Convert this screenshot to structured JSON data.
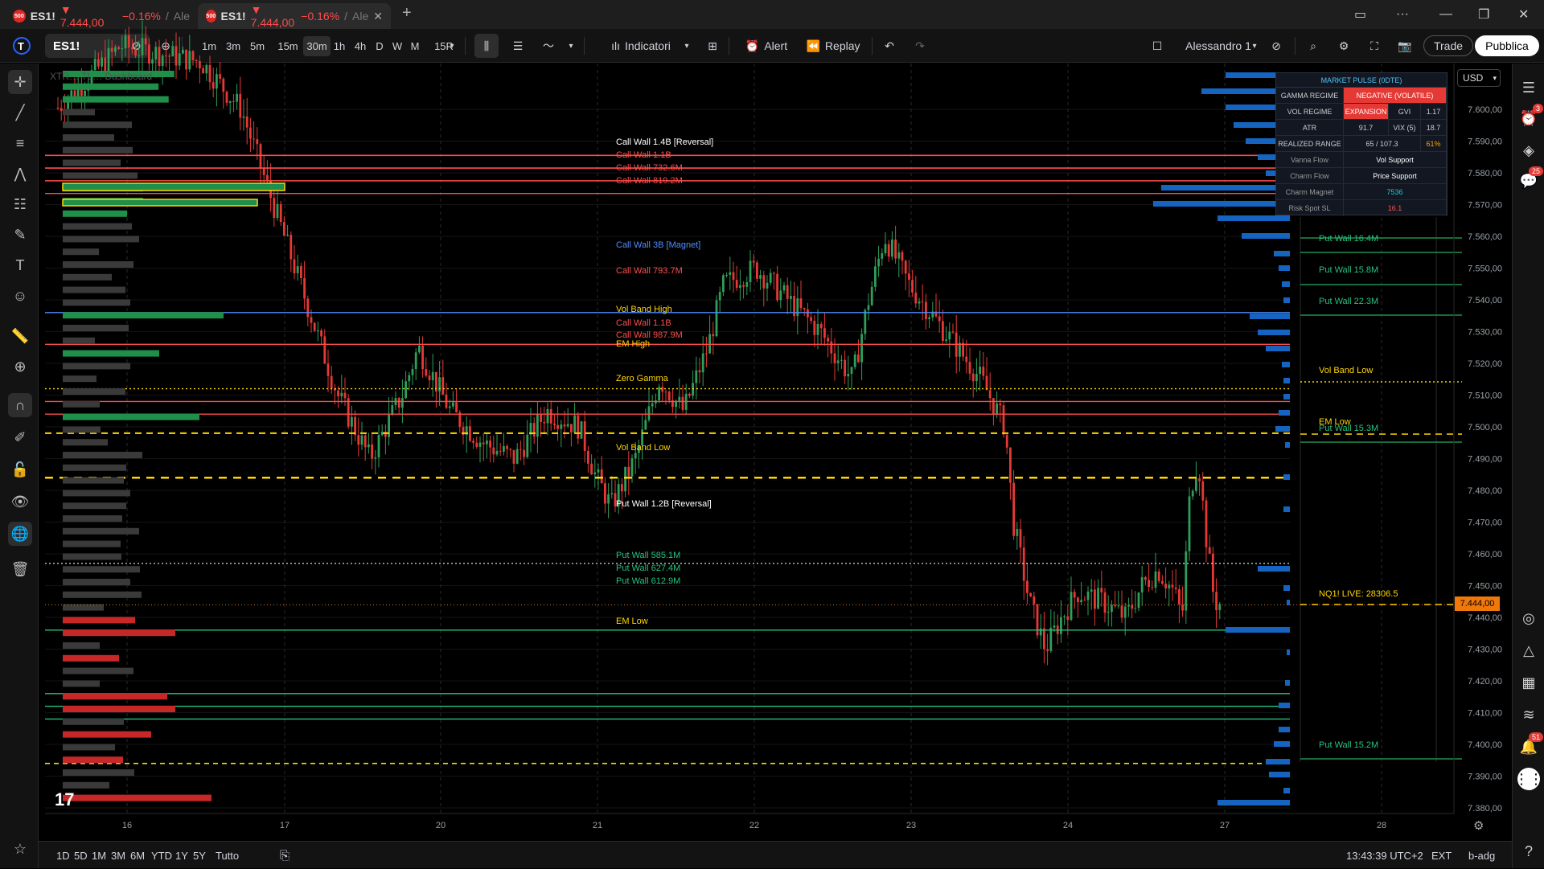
{
  "browser_tabs": [
    {
      "favicon": "500",
      "symbol": "ES1!",
      "price": "▼ 7.444,00",
      "change": "−0.16%",
      "sep": "/",
      "account": "Ale"
    },
    {
      "favicon": "500",
      "symbol": "ES1!",
      "price": "▼ 7.444,00",
      "change": "−0.16%",
      "sep": "/",
      "account": "Ale"
    }
  ],
  "toolbar": {
    "symbol": "ES1!",
    "timeframes": [
      "1m",
      "3m",
      "5m",
      "15m",
      "30m",
      "1h",
      "4h",
      "D",
      "W",
      "M",
      "15R"
    ],
    "active_timeframe": "30m",
    "indicators_label": "Indicatori",
    "alert_label": "Alert",
    "replay_label": "Replay",
    "layout_name": "Alessandro 1",
    "trade_label": "Trade",
    "publish_label": "Pubblica"
  },
  "chart": {
    "watermark": "XTR… TL… Dashboard",
    "currency": "USD",
    "last_price_label": "7.444,00",
    "date_labels": [
      "16",
      "17",
      "20",
      "21",
      "22",
      "23",
      "24",
      "27",
      "28"
    ],
    "price_ticks": [
      "7.600,00",
      "7.590,00",
      "7.580,00",
      "7.570,00",
      "7.560,00",
      "7.550,00",
      "7.540,00",
      "7.530,00",
      "7.520,00",
      "7.510,00",
      "7.500,00",
      "7.490,00",
      "7.480,00",
      "7.470,00",
      "7.460,00",
      "7.450,00",
      "7.440,00",
      "7.430,00",
      "7.420,00",
      "7.410,00",
      "7.400,00",
      "7.390,00",
      "7.380,00"
    ],
    "levels": [
      {
        "label": "Call Wall 1.4B [Reversal]",
        "text_color": "#ffffff",
        "line_color": "#ff4d4d"
      },
      {
        "label": "Call Wall 1.1B",
        "text_color": "#ff4d4d",
        "line_color": "#ff4d4d"
      },
      {
        "label": "Call Wall 732.6M",
        "text_color": "#ff4d4d",
        "line_color": "#ff4d4d"
      },
      {
        "label": "Call Wall 819.2M",
        "text_color": "#ff4d4d",
        "line_color": "#ff4d4d"
      },
      {
        "label": "Call Wall 3B [Magnet]",
        "text_color": "#4f8dff",
        "line_color": "#4f8dff"
      },
      {
        "label": "Call Wall 793.7M",
        "text_color": "#ff4d4d",
        "line_color": "#ff4d4d"
      },
      {
        "label": "Vol Band High",
        "text_color": "#ffd600",
        "line_color": "#ffd600"
      },
      {
        "label": "Call Wall 1.1B",
        "text_color": "#ff4d4d",
        "line_color": "#ff4d4d"
      },
      {
        "label": "Call Wall 987.9M",
        "text_color": "#ff4d4d",
        "line_color": "#ff4d4d"
      },
      {
        "label": "EM High",
        "text_color": "#ffd600",
        "line_color": "#ffd600"
      },
      {
        "label": "Zero Gamma",
        "text_color": "#ffd600",
        "line_color": "#ffd600"
      },
      {
        "label": "Vol Band Low",
        "text_color": "#ffd600",
        "line_color": "#dddddd"
      },
      {
        "label": "Put Wall 1.2B [Reversal]",
        "text_color": "#ffffff",
        "line_color": "#26c281"
      },
      {
        "label": "Put Wall 585.1M",
        "text_color": "#26c281",
        "line_color": "#26c281"
      },
      {
        "label": "Put Wall 627.4M",
        "text_color": "#26c281",
        "line_color": "#26c281"
      },
      {
        "label": "Put Wall 612.9M",
        "text_color": "#26c281",
        "line_color": "#26c281"
      },
      {
        "label": "EM Low",
        "text_color": "#ffd600",
        "line_color": "#ffd600"
      }
    ],
    "right_panel_labels": [
      {
        "label": "Put Wall 16.4M",
        "color": "#26c281"
      },
      {
        "label": "Put Wall 15.8M",
        "color": "#26c281"
      },
      {
        "label": "Put Wall 22.3M",
        "color": "#26c281"
      },
      {
        "label": "Vol Band Low",
        "color": "#ffd600"
      },
      {
        "label": "EM Low",
        "color": "#ffd600"
      },
      {
        "label": "Put Wall 15.3M",
        "color": "#26c281"
      },
      {
        "label": "NQ1! LIVE: 28306.5",
        "color": "#ffd600"
      },
      {
        "label": "Put Wall 15.2M",
        "color": "#26c281"
      }
    ]
  },
  "market_pulse": {
    "title": "MARKET PULSE (0DTE)",
    "gamma_regime_label": "GAMMA REGIME",
    "gamma_regime_value": "NEGATIVE (VOLATILE)",
    "vol_regime_label": "VOL REGIME",
    "vol_regime_value": "EXPANSION",
    "gvi_label": "GVI",
    "gvi_value": "1.17",
    "atr_label": "ATR",
    "atr_value": "91.7",
    "vix_label": "VIX (5)",
    "vix_value": "18.7",
    "realized_label": "REALIZED RANGE",
    "realized_value": "65 / 107.3",
    "realized_pct": "61%",
    "vanna_label": "Vanna Flow",
    "vanna_value": "Vol Support",
    "charm_label": "Charm Flow",
    "charm_value": "Price Support",
    "magnet_label": "Charm Magnet",
    "magnet_value": "7536",
    "risk_label": "Risk Spot SL",
    "risk_value": "16.1",
    "colors": {
      "negative_bg": "#e53935",
      "expansion_bg": "#e53935",
      "magnet": "#26c6da",
      "risk": "#ff5252",
      "pct": "#ffa000"
    }
  },
  "bottom": {
    "ranges": [
      "1D",
      "5D",
      "1M",
      "3M",
      "6M",
      "YTD",
      "1Y",
      "5Y",
      "Tutto"
    ],
    "clock": "13:43:39 UTC+2",
    "session": "EXT",
    "adj": "b-adg"
  },
  "right_toolbar": {
    "badges": [
      "3",
      "25",
      "51"
    ]
  },
  "icons": [
    "tradingview-logo",
    "plus-circle-icon",
    "candles-icon",
    "indicators-icon",
    "layout-icon",
    "alert-icon",
    "replay-icon",
    "undo-icon",
    "redo-icon",
    "search-icon",
    "settings-icon",
    "fullscreen-icon",
    "camera-icon"
  ]
}
